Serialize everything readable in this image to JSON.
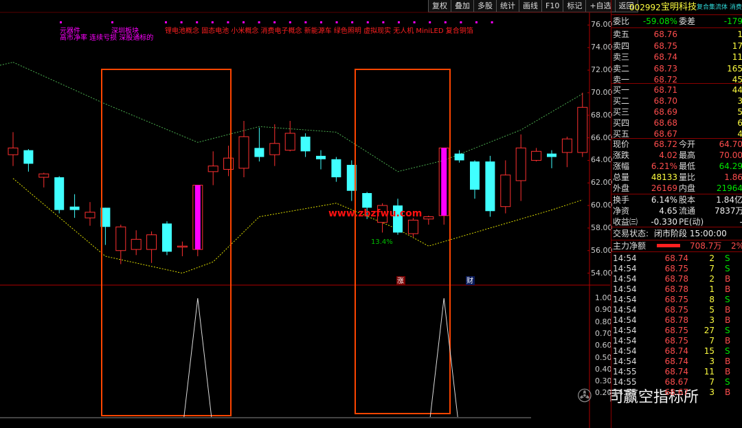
{
  "toolbar": [
    "复权",
    "叠加",
    "多股",
    "统计",
    "画线",
    "F10",
    "标记",
    "+自选",
    "返回"
  ],
  "concepts": {
    "line1_magenta": [
      "元器件",
      "深圳板块"
    ],
    "line1_red": "锂电池概念 固态电池 小米概念 消费电子概念 新能源车 绿色照明 虚拟现实 无人机 MiniLED 复合铜箔",
    "line2_magenta": "高市净率 连续亏损 深股通标的"
  },
  "price_axis": [
    "76.00",
    "74.00",
    "72.00",
    "70.00",
    "68.00",
    "66.00",
    "64.00",
    "62.00",
    "60.00",
    "58.00",
    "56.00",
    "54.00"
  ],
  "indicator_axis": [
    "1.00",
    "0.90",
    "0.80",
    "0.70",
    "0.60",
    "0.50",
    "0.40",
    "0.30",
    "0.20"
  ],
  "chart_annotations": {
    "pct_label": "13.4%",
    "badge_zhang": "涨",
    "badge_cai": "财",
    "watermark_url": "www.zbzfwu.com"
  },
  "colors": {
    "up": "#ff3030",
    "down": "#40ffff",
    "signal": "#ff00ff",
    "box": "#ff4500",
    "upper_band": "#4caf50",
    "lower_band": "#e0e000"
  },
  "quote": {
    "code": "002992",
    "name": "宝明科技",
    "scroll_text": "复合集流体 消费",
    "webi_label": "委比",
    "webi": "-59.08%",
    "weicha_label": "委差",
    "weicha": "-179",
    "asks": [
      {
        "label": "卖五",
        "price": "68.76",
        "vol": "1"
      },
      {
        "label": "卖四",
        "price": "68.75",
        "vol": "17"
      },
      {
        "label": "卖三",
        "price": "68.74",
        "vol": "11"
      },
      {
        "label": "卖二",
        "price": "68.73",
        "vol": "165"
      },
      {
        "label": "卖一",
        "price": "68.72",
        "vol": "45"
      }
    ],
    "bids": [
      {
        "label": "买一",
        "price": "68.71",
        "vol": "44"
      },
      {
        "label": "买二",
        "price": "68.70",
        "vol": "3"
      },
      {
        "label": "买三",
        "price": "68.69",
        "vol": "5"
      },
      {
        "label": "买四",
        "price": "68.68",
        "vol": "6"
      },
      {
        "label": "买五",
        "price": "68.67",
        "vol": "4"
      }
    ],
    "stats": [
      {
        "l1": "现价",
        "v1": "68.72",
        "c1": "red",
        "l2": "今开",
        "v2": "64.70",
        "c2": "red"
      },
      {
        "l1": "涨跌",
        "v1": "4.02",
        "c1": "red",
        "l2": "最高",
        "v2": "70.00",
        "c2": "red"
      },
      {
        "l1": "涨幅",
        "v1": "6.21%",
        "c1": "red",
        "l2": "最低",
        "v2": "64.29",
        "c2": "grn"
      },
      {
        "l1": "总量",
        "v1": "48133",
        "c1": "yel",
        "l2": "量比",
        "v2": "1.86",
        "c2": "red"
      },
      {
        "l1": "外盘",
        "v1": "26169",
        "c1": "red",
        "l2": "内盘",
        "v2": "21964",
        "c2": "grn"
      }
    ],
    "stats2": [
      {
        "l1": "换手",
        "v1": "6.14%",
        "c1": "wht",
        "l2": "股本",
        "v2": "1.84亿",
        "c2": "wht"
      },
      {
        "l1": "净资",
        "v1": "4.65",
        "c1": "wht",
        "l2": "流通",
        "v2": "7837万",
        "c2": "wht"
      },
      {
        "l1": "收益㈢",
        "v1": "-0.330",
        "c1": "wht",
        "l2": "PE(动)",
        "v2": "-",
        "c2": "wht"
      }
    ],
    "trade_status_label": "交易状态:",
    "trade_status": "闭市阶段 15:00:00",
    "main_net_label": "主力净额",
    "main_net": "708.7万",
    "main_net_pct": "2%",
    "trades": [
      {
        "t": "14:54",
        "p": "68.74",
        "q": "2",
        "s": "S"
      },
      {
        "t": "14:54",
        "p": "68.75",
        "q": "7",
        "s": "S"
      },
      {
        "t": "14:54",
        "p": "68.78",
        "q": "2",
        "s": "B"
      },
      {
        "t": "14:54",
        "p": "68.78",
        "q": "1",
        "s": "B"
      },
      {
        "t": "14:54",
        "p": "68.75",
        "q": "8",
        "s": "S"
      },
      {
        "t": "14:54",
        "p": "68.75",
        "q": "5",
        "s": "B"
      },
      {
        "t": "14:54",
        "p": "68.78",
        "q": "3",
        "s": "B"
      },
      {
        "t": "14:54",
        "p": "68.75",
        "q": "27",
        "s": "S"
      },
      {
        "t": "14:54",
        "p": "68.75",
        "q": "7",
        "s": "B"
      },
      {
        "t": "14:54",
        "p": "68.74",
        "q": "15",
        "s": "S"
      },
      {
        "t": "14:54",
        "p": "68.74",
        "q": "3",
        "s": "B"
      },
      {
        "t": "14:55",
        "p": "68.74",
        "q": "11",
        "s": "B"
      },
      {
        "t": "14:55",
        "p": "68.67",
        "q": "7",
        "s": "S"
      },
      {
        "t": "14:55",
        "p": "68.67",
        "q": "3",
        "s": "B"
      }
    ]
  },
  "watermark": "司赢空指标所",
  "chart_data": {
    "type": "candlestick",
    "y_range": [
      53,
      77
    ],
    "candles": [
      [
        64.5,
        65.1,
        63.5,
        66.5
      ],
      [
        64.9,
        63.7,
        63.0,
        65.0
      ],
      [
        62.5,
        62.8,
        61.6,
        62.9
      ],
      [
        62.5,
        59.6,
        59.3,
        62.6
      ],
      [
        59.9,
        59.6,
        58.9,
        61.0
      ],
      [
        58.9,
        59.4,
        58.2,
        60.3
      ],
      [
        59.8,
        58.1,
        56.5,
        59.8
      ],
      [
        56.0,
        58.1,
        54.8,
        58.3
      ],
      [
        56.1,
        57.0,
        55.6,
        57.8
      ],
      [
        56.1,
        57.4,
        54.9,
        57.7
      ],
      [
        58.4,
        55.9,
        55.6,
        58.6
      ],
      [
        56.4,
        56.4,
        55.5,
        56.8
      ],
      [
        56.1,
        61.8,
        55.5,
        61.8
      ],
      [
        63.0,
        63.5,
        61.8,
        64.8
      ],
      [
        63.2,
        64.2,
        62.6,
        65.3
      ],
      [
        63.3,
        66.1,
        62.5,
        67.5
      ],
      [
        65.1,
        64.3,
        63.9,
        66.9
      ],
      [
        64.5,
        65.5,
        63.5,
        67.2
      ],
      [
        64.9,
        66.4,
        64.8,
        67.5
      ],
      [
        66.1,
        64.8,
        64.3,
        66.4
      ],
      [
        64.4,
        64.1,
        63.2,
        64.9
      ],
      [
        64.1,
        62.5,
        62.1,
        64.3
      ],
      [
        63.6,
        61.3,
        60.4,
        64.0
      ],
      [
        61.1,
        59.8,
        58.8,
        61.2
      ],
      [
        58.5,
        60.0,
        57.6,
        60.2
      ],
      [
        60.0,
        57.6,
        57.4,
        60.6
      ],
      [
        57.5,
        58.7,
        57.2,
        58.9
      ],
      [
        58.8,
        59.0,
        58.3,
        59.1
      ],
      [
        59.1,
        65.1,
        58.3,
        65.1
      ],
      [
        64.6,
        64.0,
        63.8,
        64.9
      ],
      [
        63.9,
        61.4,
        60.6,
        64.0
      ],
      [
        63.9,
        59.5,
        59.0,
        64.4
      ],
      [
        59.9,
        62.7,
        59.3,
        64.0
      ],
      [
        62.2,
        65.1,
        60.4,
        66.3
      ],
      [
        64.0,
        64.8,
        63.9,
        65.1
      ],
      [
        64.6,
        64.3,
        63.3,
        64.9
      ],
      [
        64.7,
        65.9,
        63.4,
        66.1
      ],
      [
        64.7,
        68.7,
        64.3,
        70.0
      ]
    ],
    "signal_candles": [
      12,
      28
    ],
    "upper_band": [
      [
        0,
        72.7
      ],
      [
        6,
        69
      ],
      [
        12,
        65.6
      ],
      [
        16,
        67
      ],
      [
        21,
        66.5
      ],
      [
        25,
        63
      ],
      [
        28,
        64
      ],
      [
        33,
        66.7
      ],
      [
        37,
        69.9
      ]
    ],
    "lower_band": [
      [
        0,
        62.4
      ],
      [
        6,
        55.5
      ],
      [
        11,
        54
      ],
      [
        13,
        55
      ],
      [
        16,
        59
      ],
      [
        21,
        60.2
      ],
      [
        25,
        57.9
      ],
      [
        27,
        56.4
      ],
      [
        31,
        58
      ],
      [
        35,
        59.6
      ],
      [
        37,
        60.5
      ]
    ],
    "indicator_peaks": [
      12,
      28
    ],
    "indicator_range": [
      0,
      1
    ]
  }
}
